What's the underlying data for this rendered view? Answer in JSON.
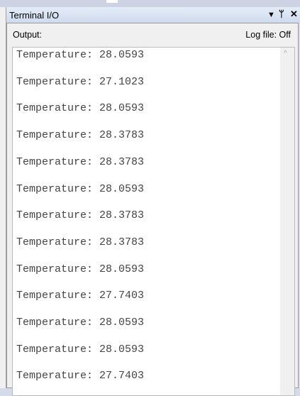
{
  "window": {
    "title": "Terminal I/O",
    "buttons": {
      "dropdown": "▼",
      "pin": "ᛘ",
      "close": "✕"
    }
  },
  "panel": {
    "output_label": "Output:",
    "log_file": "Log file: Off"
  },
  "lines": [
    "Temperature: 28.0593",
    "Temperature: 27.1023",
    "Temperature: 28.0593",
    "Temperature: 28.3783",
    "Temperature: 28.3783",
    "Temperature: 28.0593",
    "Temperature: 28.3783",
    "Temperature: 28.3783",
    "Temperature: 28.0593",
    "Temperature: 27.7403",
    "Temperature: 28.0593",
    "Temperature: 28.0593",
    "Temperature: 27.7403"
  ],
  "scrollbar": {
    "up_arrow": "^"
  }
}
